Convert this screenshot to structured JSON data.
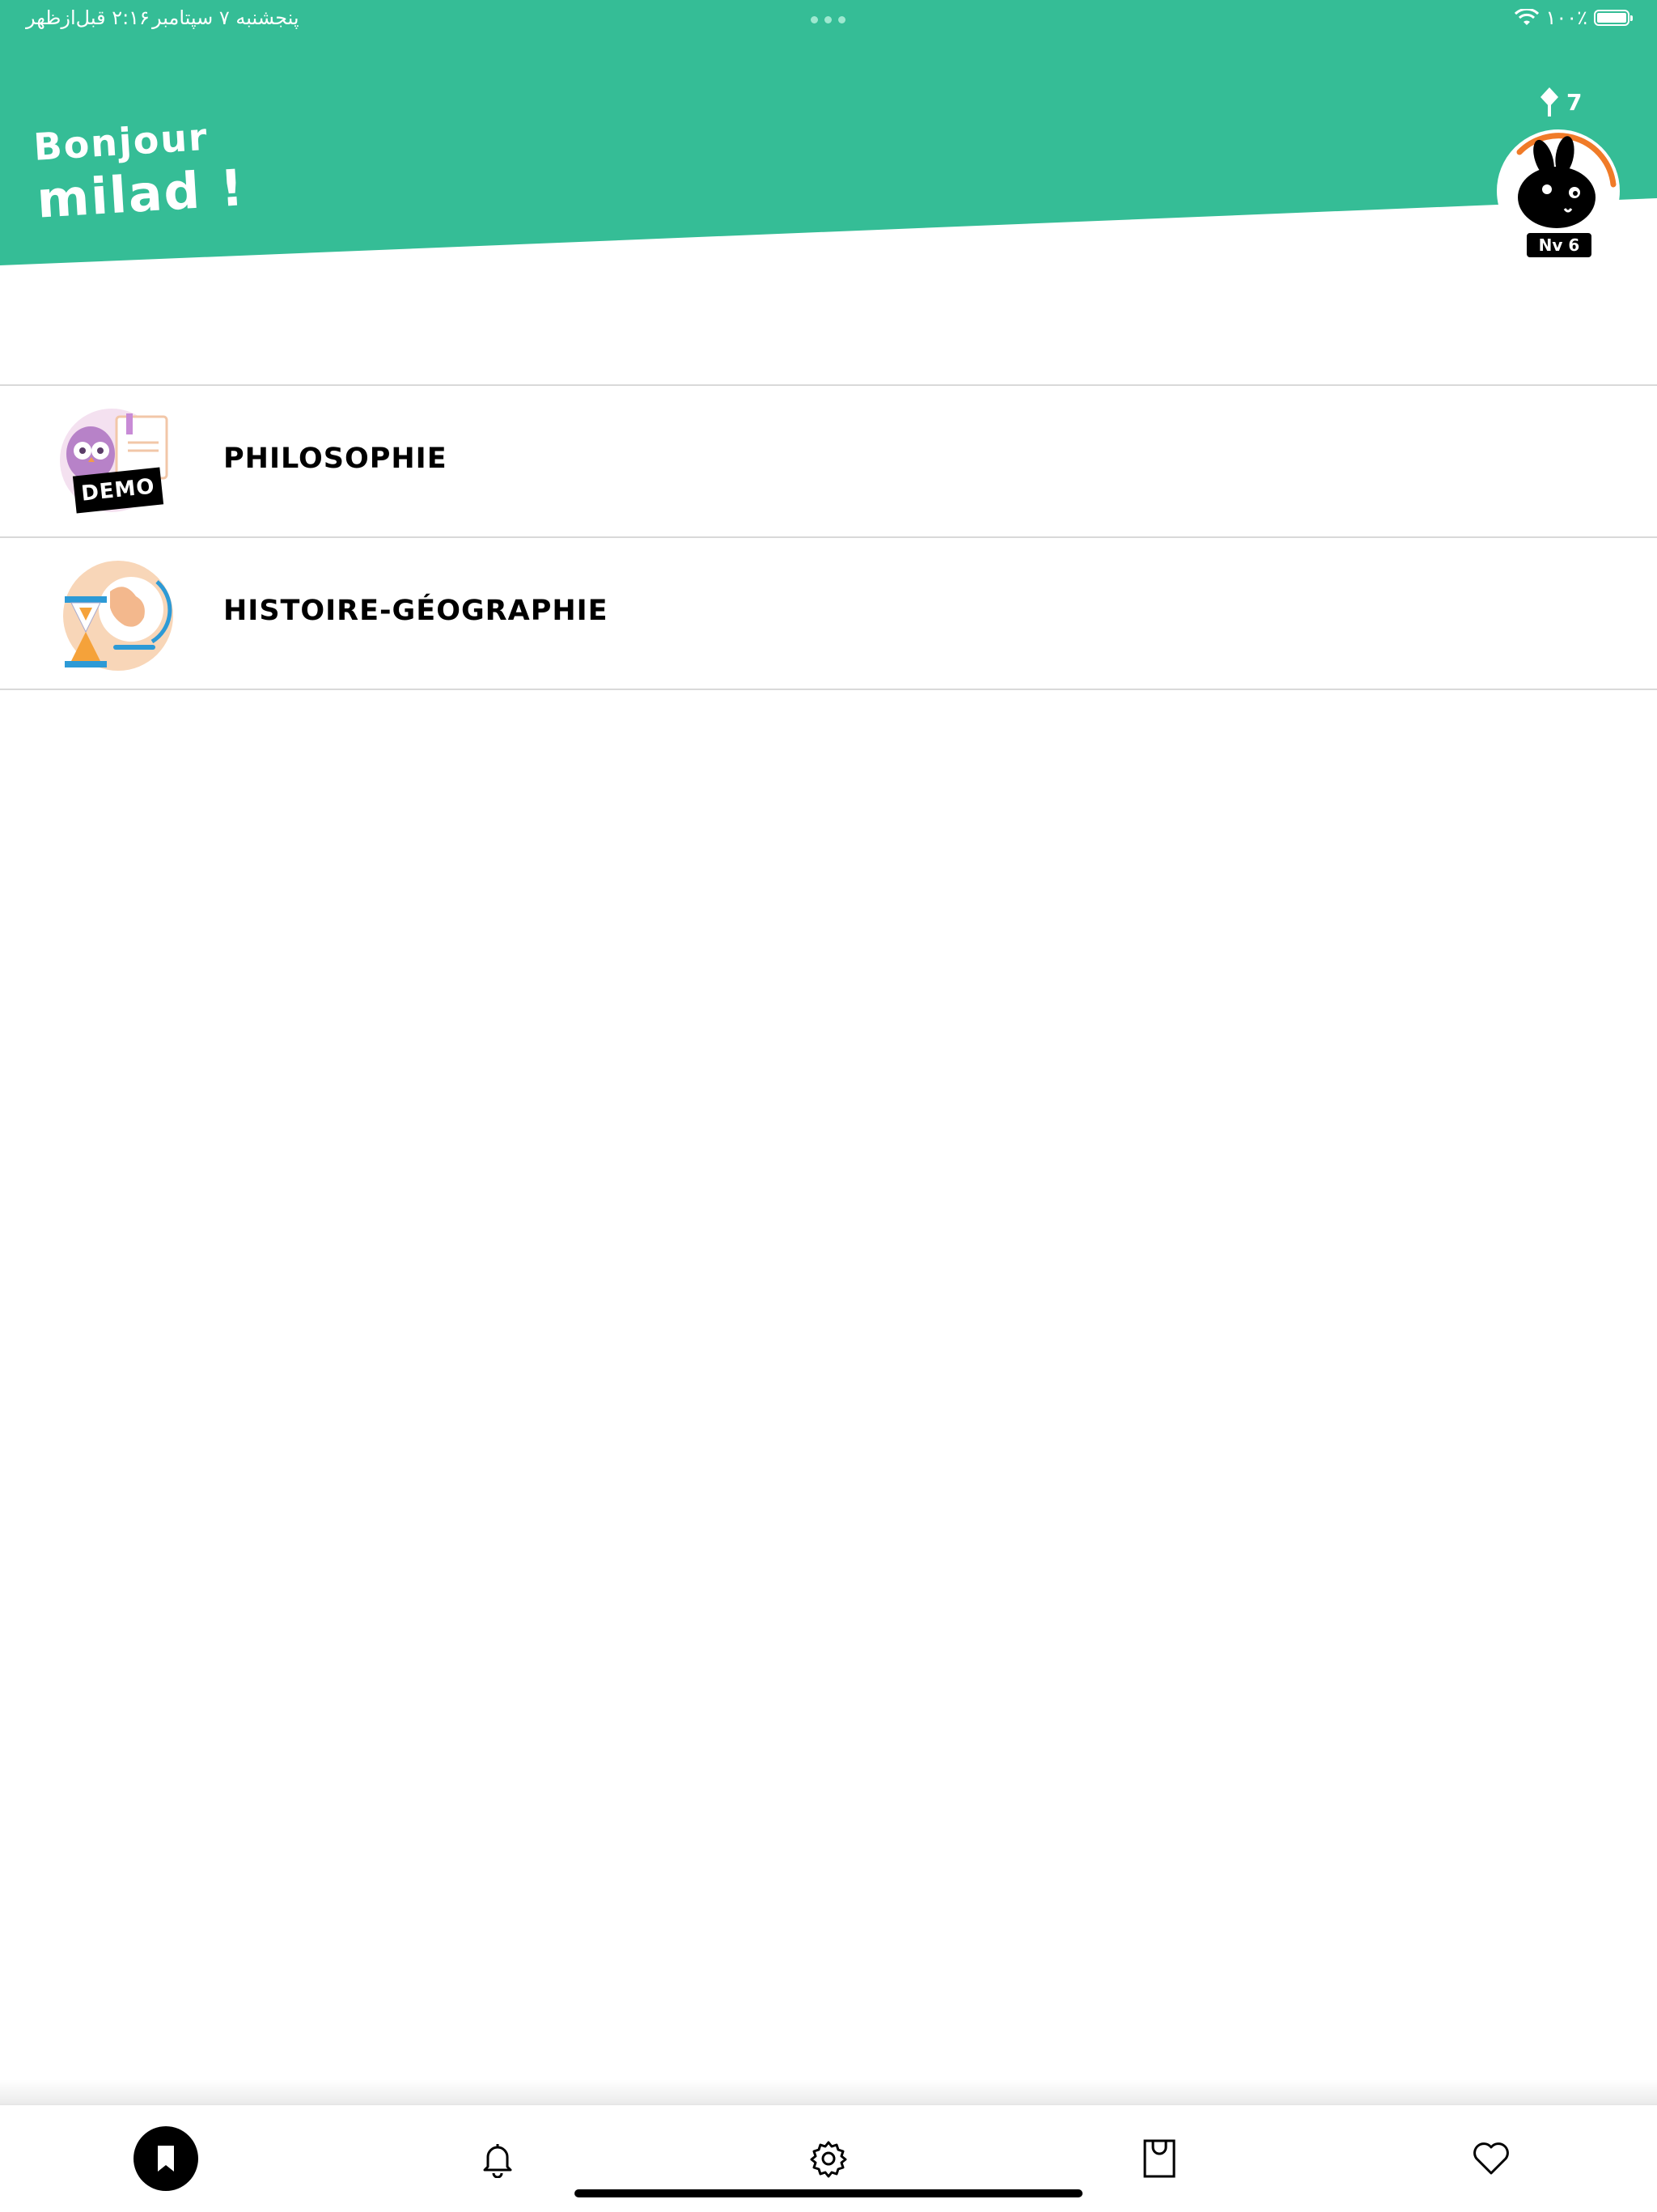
{
  "status_bar": {
    "time": "۲:۱۶ قبل‌ازظهر",
    "date": "پنجشنبه ۷ سپتامبر",
    "battery_percent": "۱۰۰٪"
  },
  "header": {
    "greeting_line1": "Bonjour",
    "greeting_line2": "milad !",
    "gems_count": "7",
    "level_label": "Nv 6",
    "background_color": "#35bd96",
    "progress_color": "#f07b28"
  },
  "subjects": [
    {
      "label": "PHILOSOPHIE",
      "badge": "DEMO",
      "icon": "owl-book-icon"
    },
    {
      "label": "HISTOIRE-GÉOGRAPHIE",
      "icon": "hourglass-globe-icon"
    }
  ],
  "tabbar": {
    "tabs": [
      {
        "name": "bookmark-icon",
        "active": true
      },
      {
        "name": "bell-icon",
        "active": false
      },
      {
        "name": "gear-icon",
        "active": false
      },
      {
        "name": "shopping-bag-icon",
        "active": false
      },
      {
        "name": "heart-icon",
        "active": false
      }
    ]
  }
}
